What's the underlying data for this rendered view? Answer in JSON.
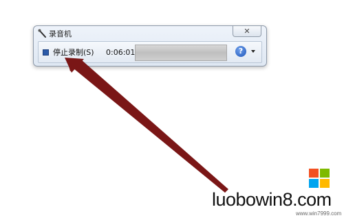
{
  "window": {
    "title": "录音机",
    "close_label": "✕",
    "stop_label": "停止录制(S)",
    "elapsed_time": "0:06:01",
    "help_symbol": "?"
  },
  "watermark": {
    "text": "luobowin8.com",
    "small_text": "www.win7999.com"
  },
  "colors": {
    "arrow": "#7a1616",
    "logo_red": "#f25022",
    "logo_green": "#7fba00",
    "logo_blue": "#00a4ef",
    "logo_yellow": "#ffb900"
  }
}
